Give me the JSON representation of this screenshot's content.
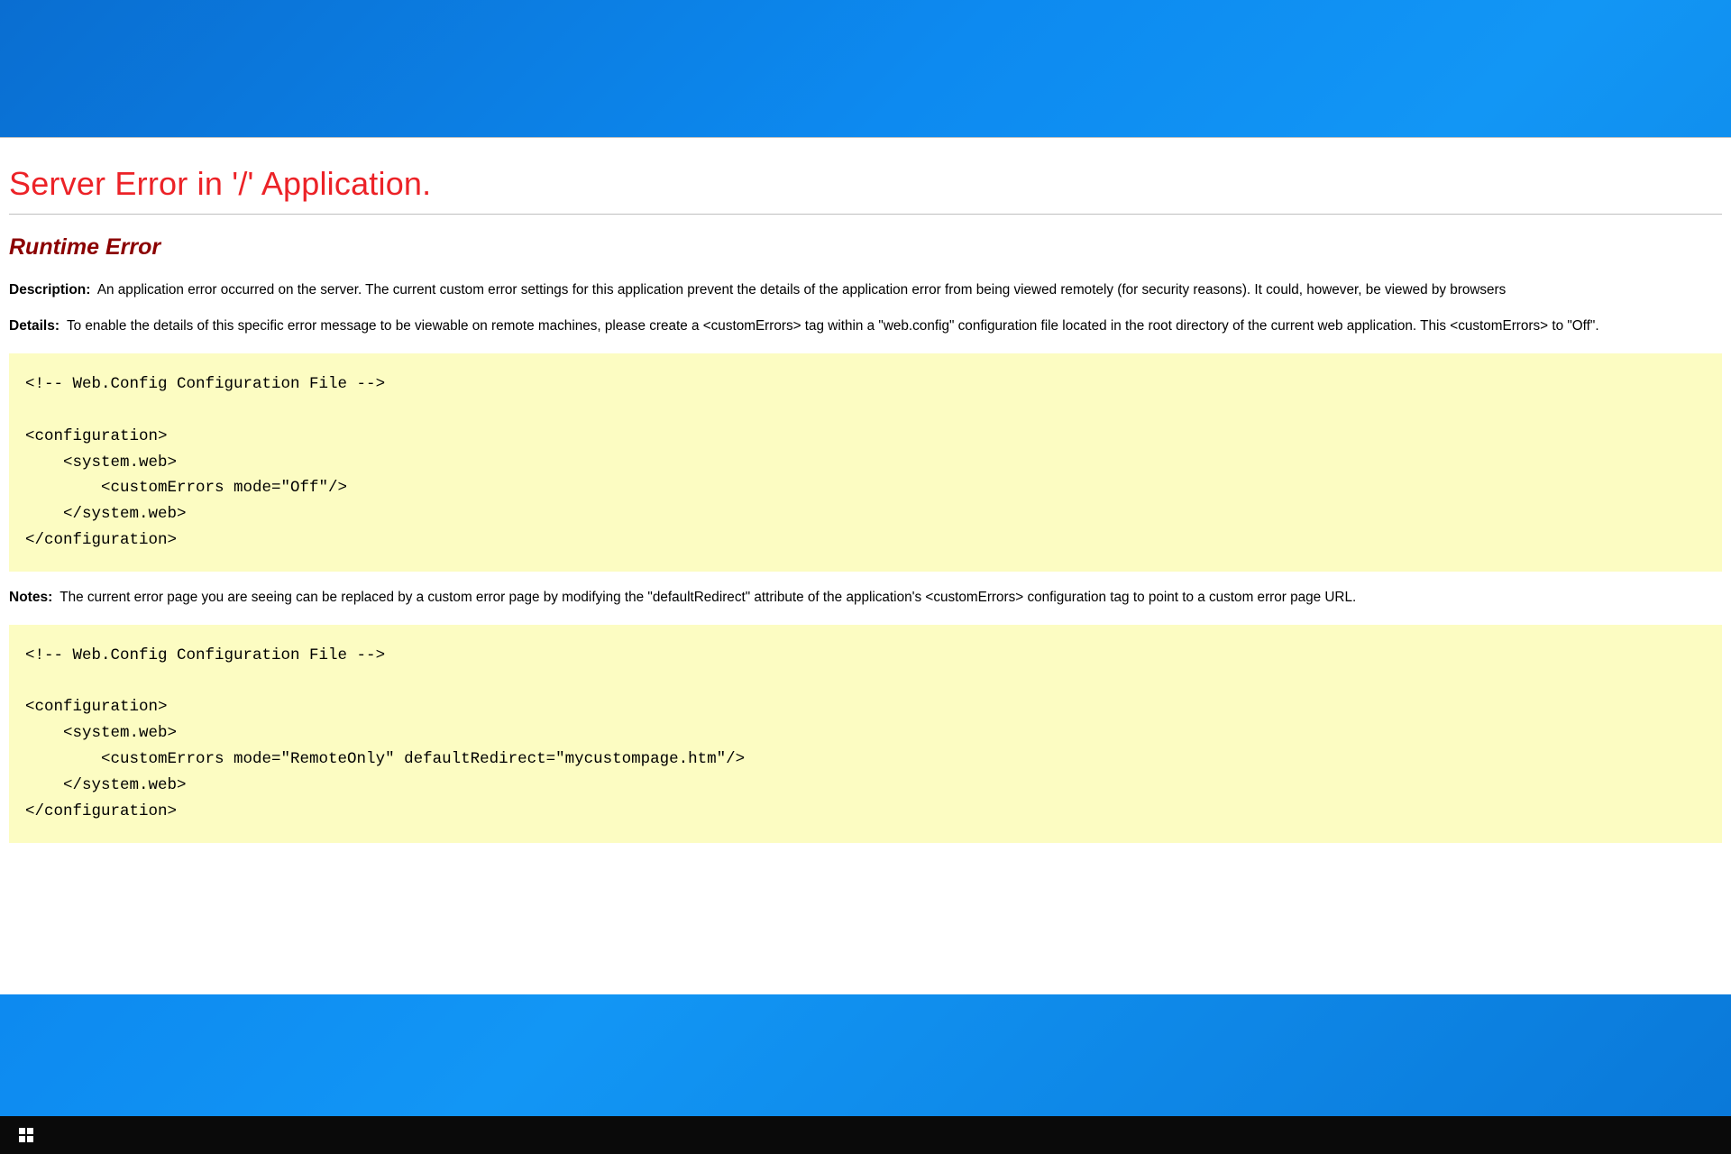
{
  "error": {
    "title": "Server Error in '/' Application.",
    "subtitle": "Runtime Error",
    "description_label": "Description:",
    "description_text": "An application error occurred on the server. The current custom error settings for this application prevent the details of the application error from being viewed remotely (for security reasons). It could, however, be viewed by browsers",
    "details_label": "Details:",
    "details_text": "To enable the details of this specific error message to be viewable on remote machines, please create a <customErrors> tag within a \"web.config\" configuration file located in the root directory of the current web application. This <customErrors> to \"Off\".",
    "code1": "<!-- Web.Config Configuration File -->\n\n<configuration>\n    <system.web>\n        <customErrors mode=\"Off\"/>\n    </system.web>\n</configuration>",
    "notes_label": "Notes:",
    "notes_text": "The current error page you are seeing can be replaced by a custom error page by modifying the \"defaultRedirect\" attribute of the application's <customErrors> configuration tag to point to a custom error page URL.",
    "code2": "<!-- Web.Config Configuration File -->\n\n<configuration>\n    <system.web>\n        <customErrors mode=\"RemoteOnly\" defaultRedirect=\"mycustompage.htm\"/>\n    </system.web>\n</configuration>"
  }
}
